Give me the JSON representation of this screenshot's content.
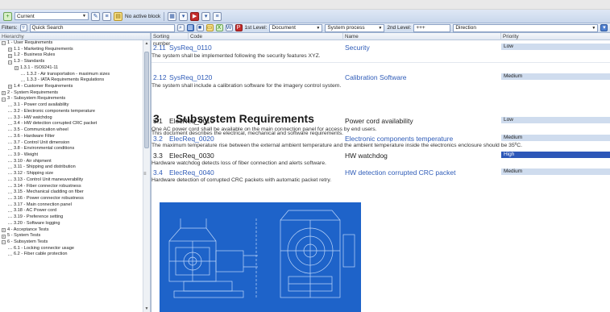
{
  "toolbar": {
    "baseline_value": "Current",
    "no_active_block": "No active block",
    "colors": {
      "bar": "#dfe8f5",
      "accent": "#2f5cb8",
      "selection": "#2d57b8"
    }
  },
  "filterbar": {
    "filters_label": "Filters:",
    "quick_search": "Quick Search",
    "level1_label": "1st Level:",
    "level1_value": "Document",
    "system_process": "System process",
    "level2_label": "2nd Level:",
    "level2_value": "+++",
    "direction_label": "Direction"
  },
  "tree": {
    "header": "Hierarchy",
    "items": [
      {
        "label": "1 - User Requirements",
        "exp": "−",
        "depth": 0
      },
      {
        "label": "1.1 - Marketing Requirements",
        "exp": "+",
        "depth": 1
      },
      {
        "label": "1.2 - Business Rules",
        "exp": "+",
        "depth": 1
      },
      {
        "label": "1.3 - Standards",
        "exp": "−",
        "depth": 1
      },
      {
        "label": "1.3.1 - ISO9241-11",
        "exp": "+",
        "depth": 2
      },
      {
        "label": "1.3.2 - Air transportation - maximum sizes",
        "exp": "",
        "depth": 3
      },
      {
        "label": "1.3.3 - IATA Requirements Regulations",
        "exp": "",
        "depth": 3
      },
      {
        "label": "1.4 - Customer Requirements",
        "exp": "+",
        "depth": 1
      },
      {
        "label": "2 - System Requirements",
        "exp": "+",
        "depth": 0
      },
      {
        "label": "3 - Subsystem Requirements",
        "exp": "−",
        "depth": 0
      },
      {
        "label": "3.1 - Power cord availability",
        "exp": "",
        "depth": 1
      },
      {
        "label": "3.2 - Electronic components temperature",
        "exp": "",
        "depth": 1
      },
      {
        "label": "3.3 - HW watchdog",
        "exp": "",
        "depth": 1
      },
      {
        "label": "3.4 - HW detection corrupted CRC packet",
        "exp": "",
        "depth": 1
      },
      {
        "label": "3.5 - Communication wheel",
        "exp": "",
        "depth": 1
      },
      {
        "label": "3.6 - Hardware Filter",
        "exp": "",
        "depth": 1
      },
      {
        "label": "3.7 - Control Unit dimension",
        "exp": "",
        "depth": 1
      },
      {
        "label": "3.8 - Environmental conditions",
        "exp": "",
        "depth": 1
      },
      {
        "label": "3.9 - Weight",
        "exp": "",
        "depth": 1
      },
      {
        "label": "3.10 - Air shipment",
        "exp": "",
        "depth": 1
      },
      {
        "label": "3.11 - Shipping and distribution",
        "exp": "",
        "depth": 1
      },
      {
        "label": "3.12 - Shipping size",
        "exp": "",
        "depth": 1
      },
      {
        "label": "3.13 - Control Unit maneuverability",
        "exp": "",
        "depth": 1
      },
      {
        "label": "3.14 - Fiber connector robustness",
        "exp": "",
        "depth": 1
      },
      {
        "label": "3.15 - Mechanical cladding on fiber",
        "exp": "",
        "depth": 1
      },
      {
        "label": "3.16 - Power connector robustness",
        "exp": "",
        "depth": 1
      },
      {
        "label": "3.17 - Main connection panel",
        "exp": "",
        "depth": 1
      },
      {
        "label": "3.18 - AC Power cord",
        "exp": "",
        "depth": 1
      },
      {
        "label": "3.19 - Preference setting",
        "exp": "",
        "depth": 1
      },
      {
        "label": "3.20 - Software logging",
        "exp": "",
        "depth": 1
      },
      {
        "label": "4 - Acceptance Tests",
        "exp": "+",
        "depth": 0
      },
      {
        "label": "5 - System Tests",
        "exp": "+",
        "depth": 0
      },
      {
        "label": "6 - Subsystem Tests",
        "exp": "−",
        "depth": 0
      },
      {
        "label": "6.1 - Locking connector usage",
        "exp": "",
        "depth": 1
      },
      {
        "label": "6.2 - Fiber cable protection",
        "exp": "",
        "depth": 1
      }
    ]
  },
  "grid": {
    "col_sorting": "Sorting number",
    "col_code": "Code",
    "col_name": "Name",
    "col_priority": "Priority"
  },
  "reqs": [
    {
      "num": "2.11",
      "code": "SysReq_0110",
      "name": "Security",
      "priority": "Low",
      "desc": "The system shall be implemented following the security features XYZ."
    },
    {
      "num": "2.12",
      "code": "SysReq_0120",
      "name": "Calibration Software",
      "priority": "Medium",
      "desc": "The system shall include a calibration software for the imagery control system."
    }
  ],
  "section": {
    "num": "3",
    "title": "Subsystem Requirements",
    "desc": "This document describes the electrical, mechanical and software requirements."
  },
  "subreqs": [
    {
      "num": "3.1",
      "code": "ElecReq_0010",
      "name": "Power cord availability",
      "priority": "Low",
      "desc": "One AC power cord shall be available on the main connection panel for access by end users."
    },
    {
      "num": "3.2",
      "code": "ElecReq_0020",
      "name": "Electronic components temperature",
      "priority": "Medium",
      "desc": "The maximum temperature rise between the external ambient temperature and the ambient temperature inside the electronics enclosure should be 35ºC."
    },
    {
      "num": "3.3",
      "code": "ElecReq_0030",
      "name": "HW watchdog",
      "priority": "High",
      "desc": "Hardware watchdog detects loss of fiber connection and alerts software."
    },
    {
      "num": "3.4",
      "code": "ElecReq_0040",
      "name": "HW detection corrupted CRC packet",
      "priority": "Medium",
      "desc": "Hardware detection of corrupted CRC packets with automatic packet retry."
    }
  ]
}
